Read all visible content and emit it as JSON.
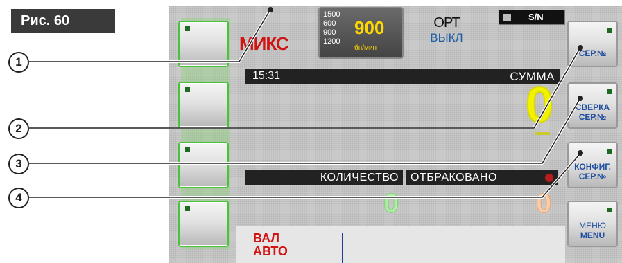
{
  "figure": {
    "label": "Рис. 60"
  },
  "header": {
    "mode": "МИКС",
    "speed": {
      "options": [
        "1500",
        "600",
        "900",
        "1200"
      ],
      "value": "900",
      "unit": "бн/мин"
    },
    "orientation": {
      "label": "ОРТ",
      "state": "ВЫКЛ"
    },
    "sn_label": "S/N"
  },
  "display": {
    "time": "15:31",
    "sum_label": "СУММА",
    "sum_value": "0",
    "count_label": "КОЛИЧЕСТВО",
    "reject_label": "ОТБРАКОВАНО",
    "count_value": "0",
    "reject_value": "0"
  },
  "footer": {
    "currency_line1": "ВАЛ",
    "currency_line2": "АВТО"
  },
  "right_buttons": [
    {
      "line1": "СЕР.№",
      "line2": ""
    },
    {
      "line1": "СВЕРКА",
      "line2": "СЕР.№"
    },
    {
      "line1": "КОНФИГ.",
      "line2": "СЕР.№"
    },
    {
      "line1": "МЕНЮ",
      "line2": "MENU"
    }
  ],
  "callouts": [
    "1",
    "2",
    "3",
    "4"
  ],
  "colors": {
    "mode": "#d01414",
    "sum_value": "#f2f200",
    "count_value": "#aaf0a0",
    "reject_value": "#ffcba4",
    "led": "#1d6b23",
    "accent_blue": "#1f4fa0",
    "left_button_border": "#49c43a"
  }
}
